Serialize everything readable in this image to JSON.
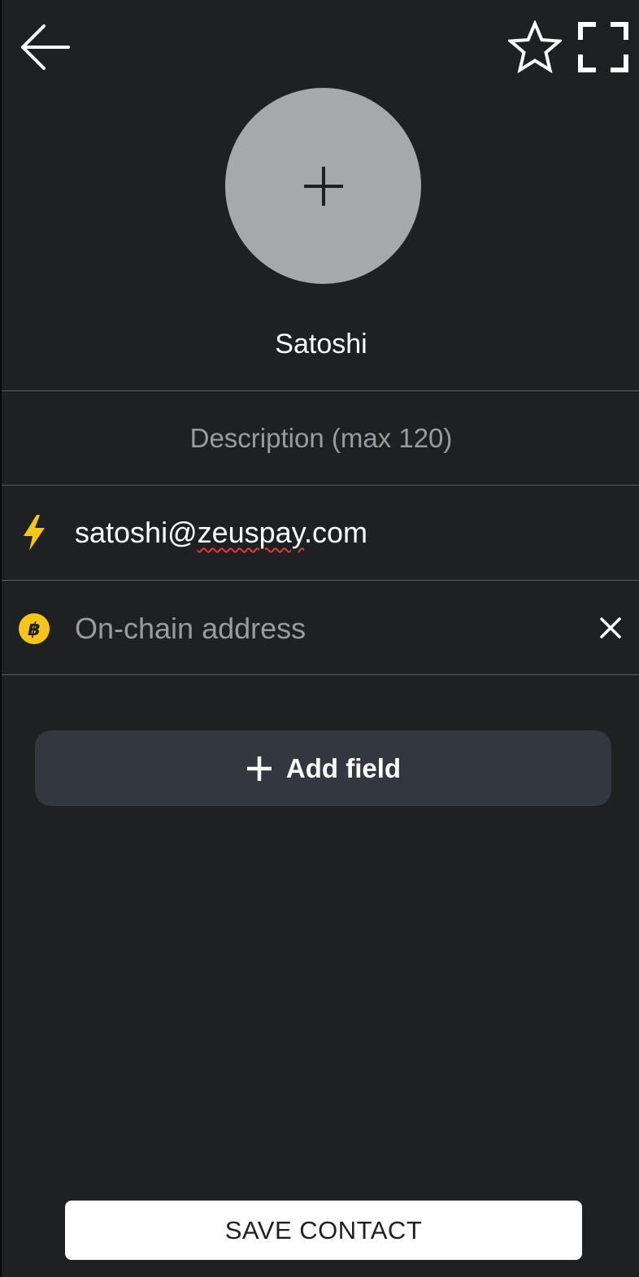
{
  "colors": {
    "background": "#1f2022",
    "divider": "#5a5c60",
    "avatar_bg": "#a7a8ab",
    "lightning": "#f5c518",
    "bitcoin": "#f5c518",
    "add_field_bg": "#333740",
    "save_button_bg": "#ffffff",
    "spellcheck_underline": "#e03a3a"
  },
  "header": {
    "back_icon": "arrow-left-icon",
    "favorite_icon": "star-outline-icon",
    "scan_icon": "scan-frame-icon"
  },
  "avatar": {
    "icon": "plus-icon"
  },
  "contact": {
    "name": "Satoshi",
    "description_placeholder": "Description (max 120)"
  },
  "fields": {
    "lightning": {
      "icon": "lightning-icon",
      "value_prefix": "satoshi@",
      "value_misspelled": "zeuspay",
      "value_suffix": ".com"
    },
    "onchain": {
      "icon": "bitcoin-icon",
      "placeholder": "On-chain address",
      "clear_icon": "close-icon"
    }
  },
  "add_field": {
    "label": "Add field",
    "icon": "plus-icon"
  },
  "save_button": {
    "label": "SAVE CONTACT"
  }
}
